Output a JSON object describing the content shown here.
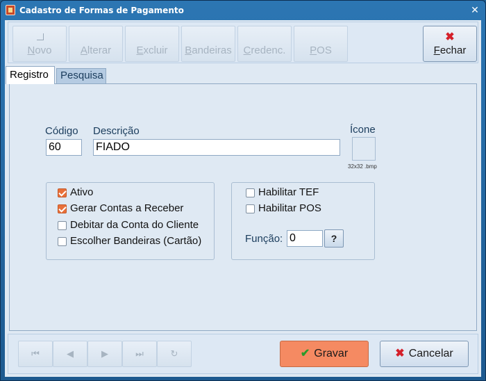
{
  "window": {
    "title": "Cadastro de Formas de Pagamento",
    "close": "✕"
  },
  "toolbar": {
    "buttons": [
      {
        "label": "Novo"
      },
      {
        "label": "Alterar"
      },
      {
        "label": "Excluir"
      },
      {
        "label": "Bandeiras"
      },
      {
        "label": "Credenc."
      },
      {
        "label": "POS"
      }
    ],
    "close_label": "Fechar",
    "close_icon": "✖"
  },
  "tabs": [
    {
      "label": "Registro",
      "active": true
    },
    {
      "label": "Pesquisa",
      "active": false
    }
  ],
  "form": {
    "codigo_label": "Código",
    "codigo_value": "60",
    "descricao_label": "Descrição",
    "descricao_value": "FIADO",
    "icone_label": "Ícone",
    "icone_note": "32x32 .bmp",
    "options_left": [
      {
        "label": "Ativo",
        "checked": true
      },
      {
        "label": "Gerar Contas a Receber",
        "checked": true
      },
      {
        "label": "Debitar da Conta do Cliente",
        "checked": false
      },
      {
        "label": "Escolher Bandeiras (Cartão)",
        "checked": false
      }
    ],
    "options_right": [
      {
        "label": "Habilitar TEF",
        "checked": false
      },
      {
        "label": "Habilitar POS",
        "checked": false
      }
    ],
    "funcao_label": "Função:",
    "funcao_value": "0",
    "help_label": "?"
  },
  "footer": {
    "nav": [
      "⏮",
      "◀",
      "▶",
      "⏭",
      "↻"
    ],
    "save_label": "Gravar",
    "save_icon": "✔",
    "cancel_label": "Cancelar",
    "cancel_icon": "✖"
  }
}
